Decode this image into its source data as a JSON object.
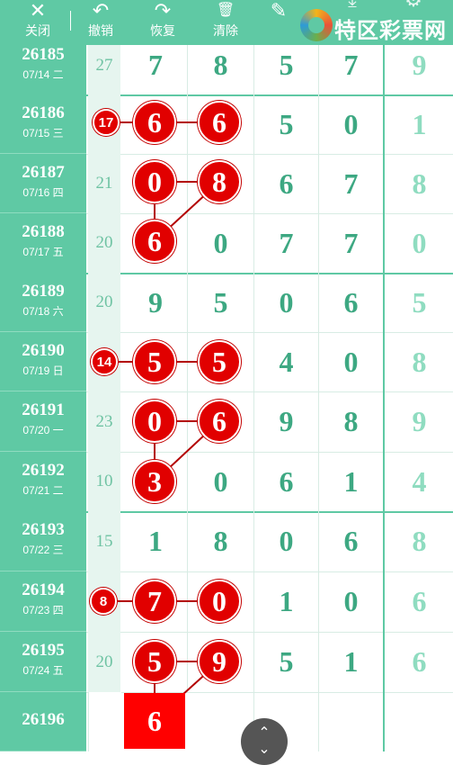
{
  "toolbar": {
    "close": {
      "icon": "✕",
      "label": "关闭"
    },
    "undo": {
      "icon": "↶",
      "label": "撤销"
    },
    "redo": {
      "icon": "↷",
      "label": "恢复"
    },
    "clear": {
      "icon": "🗑",
      "label": "清除"
    },
    "edit": {
      "icon": "✎"
    },
    "download": {
      "icon": "⤓"
    },
    "settings": {
      "icon": "⚙"
    },
    "brand": "特区彩票网"
  },
  "rows": [
    {
      "issue": "26185",
      "date": "07/14 二",
      "sum": "27",
      "digits": [
        "7",
        "8",
        "5",
        "7",
        "9"
      ]
    },
    {
      "issue": "26186",
      "date": "07/15 三",
      "sum": "17",
      "digits": [
        "6",
        "6",
        "5",
        "0",
        "1"
      ]
    },
    {
      "issue": "26187",
      "date": "07/16 四",
      "sum": "21",
      "digits": [
        "0",
        "8",
        "6",
        "7",
        "8"
      ]
    },
    {
      "issue": "26188",
      "date": "07/17 五",
      "sum": "20",
      "digits": [
        "6",
        "0",
        "7",
        "7",
        "0"
      ]
    },
    {
      "issue": "26189",
      "date": "07/18 六",
      "sum": "20",
      "digits": [
        "9",
        "5",
        "0",
        "6",
        "5"
      ]
    },
    {
      "issue": "26190",
      "date": "07/19 日",
      "sum": "14",
      "digits": [
        "5",
        "5",
        "4",
        "0",
        "8"
      ]
    },
    {
      "issue": "26191",
      "date": "07/20 一",
      "sum": "23",
      "digits": [
        "0",
        "6",
        "9",
        "8",
        "9"
      ]
    },
    {
      "issue": "26192",
      "date": "07/21 二",
      "sum": "10",
      "digits": [
        "3",
        "0",
        "6",
        "1",
        "4"
      ]
    },
    {
      "issue": "26193",
      "date": "07/22 三",
      "sum": "15",
      "digits": [
        "1",
        "8",
        "0",
        "6",
        "8"
      ]
    },
    {
      "issue": "26194",
      "date": "07/23 四",
      "sum": "8",
      "digits": [
        "7",
        "0",
        "1",
        "0",
        "6"
      ]
    },
    {
      "issue": "26195",
      "date": "07/24 五",
      "sum": "20",
      "digits": [
        "5",
        "9",
        "5",
        "1",
        "6"
      ]
    },
    {
      "issue": "26196",
      "date": "",
      "sum": "",
      "digits": [
        "6",
        "",
        "",
        "",
        ""
      ]
    }
  ],
  "scroll_button": {
    "up": "⌃",
    "down": "⌄"
  }
}
